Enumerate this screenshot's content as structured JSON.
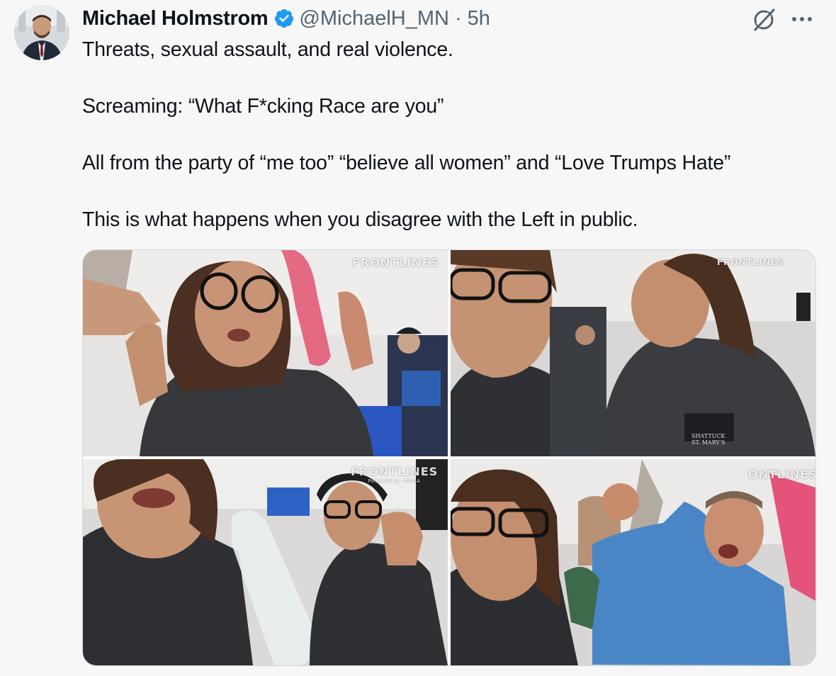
{
  "author": {
    "name": "Michael Holmstrom",
    "handle": "@MichaelH_MN",
    "separator": "·",
    "time": "5h",
    "verified": true,
    "avatar": "profile-photo"
  },
  "actions": {
    "grok_icon": "grok-slash-icon",
    "more_icon": "more-dots-icon"
  },
  "tweet": {
    "line1": "Threats, sexual assault, and real violence.",
    "line2": "Screaming: “What F*cking Race are you”",
    "line3": "All from the party of “me too” “believe all women” and “Love Trumps Hate”",
    "line4": "This is what happens when you disagree with the Left in public."
  },
  "media": {
    "watermarks": [
      {
        "main": "FRONTLINES",
        "sub": ""
      },
      {
        "main": "FRONTLINES",
        "sub": ""
      },
      {
        "main": "FRONTLINES",
        "sub": "Powered by TPUSA"
      },
      {
        "main": "ONTLINES",
        "sub": ""
      }
    ],
    "jacket_text": "SHATTUCK ST. MARY'S"
  },
  "colors": {
    "verified_blue": "#1d9bf0",
    "muted_text": "#536471",
    "background": "#f7f7f8"
  }
}
